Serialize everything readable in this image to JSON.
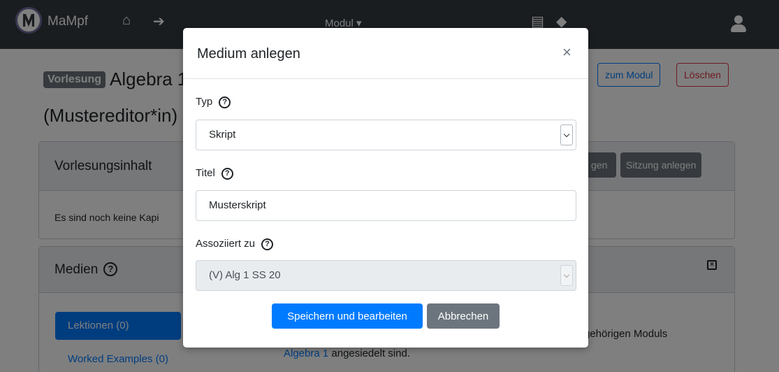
{
  "navbar": {
    "brand": "MaMpf",
    "module_dropdown": "Modul ▾",
    "home_icon": "home-icon",
    "logout_icon": "sign-out-icon",
    "user_icon": "user-icon"
  },
  "page": {
    "badge": "Vorlesung",
    "title": "Algebra 1",
    "subtitle": "(Mustereditor*in)",
    "zum_modul_button": "zum Modul",
    "delete_button": "Löschen"
  },
  "lecture_content_card": {
    "title": "Vorlesungsinhalt",
    "partial_button": "gen",
    "session_button": "Sitzung anlegen",
    "body_text": "Es sind noch keine Kapi"
  },
  "media_card": {
    "title": "Medien",
    "active_tab": "Lektionen (0)",
    "tab_worked_examples": "Worked Examples (0)",
    "text_part1": "gehörigen Moduls",
    "link": "Algebra 1",
    "text_part2": " angesiedelt sind."
  },
  "modal": {
    "title": "Medium anlegen",
    "close": "×",
    "typ_label": "Typ",
    "typ_value": "Skript",
    "titel_label": "Titel",
    "titel_value": "Musterskript",
    "assoziiert_label": "Assoziiert zu",
    "assoziiert_value": "(V) Alg 1 SS 20",
    "save_button": "Speichern und bearbeiten",
    "cancel_button": "Abbrechen",
    "help_glyph": "?"
  },
  "colors": {
    "primary": "#007bff",
    "secondary": "#6c757d",
    "danger": "#dc3545",
    "navbar": "#343a40"
  }
}
